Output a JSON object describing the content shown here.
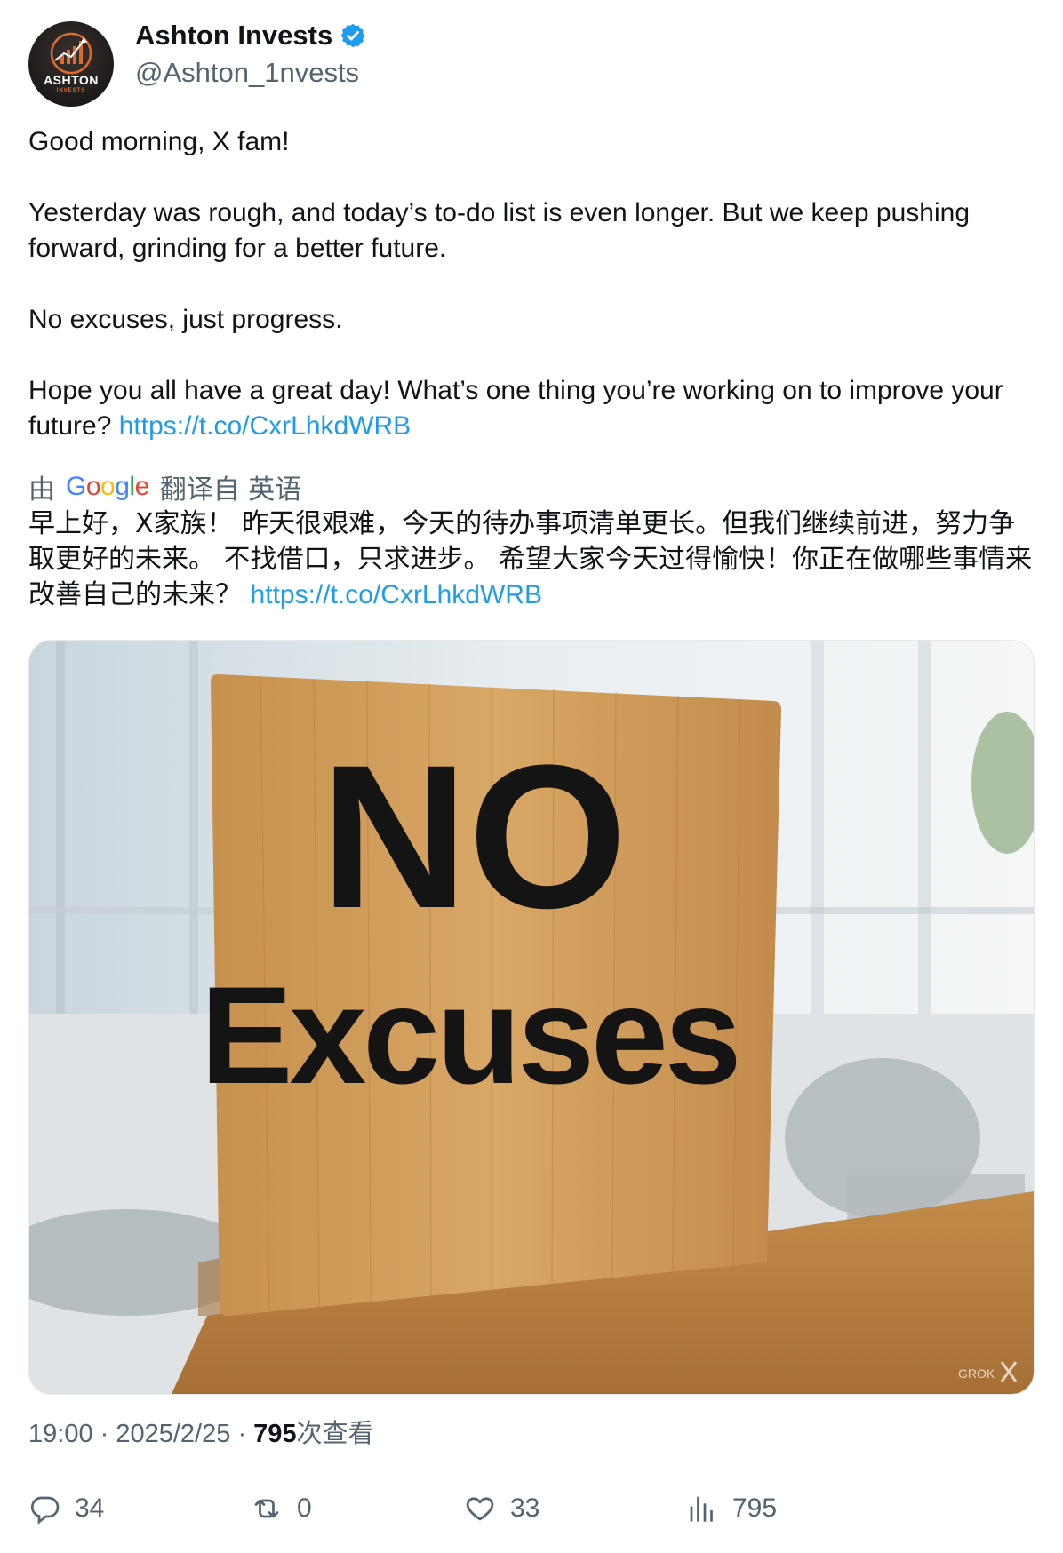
{
  "author": {
    "display_name": "Ashton Invests",
    "handle": "@Ashton_1nvests",
    "avatar_text": "ASHTON",
    "avatar_subtext": "INVESTS",
    "verified": true
  },
  "tweet": {
    "paragraphs": [
      "Good morning, X fam!",
      "Yesterday was rough, and today’s to-do list is even longer. But we keep pushing forward, grinding for a better future.",
      "No excuses, just progress.",
      "Hope you all have a great day! What’s one thing you’re working on to improve your future?"
    ],
    "link": "https://t.co/CxrLhkdWRB"
  },
  "translation": {
    "prefix": "由",
    "provider": "Google",
    "label": "翻译自 英语",
    "text": "早上好，X家族！ 昨天很艰难，今天的待办事项清单更长。但我们继续前进，努力争取更好的未来。 不找借口，只求进步。 希望大家今天过得愉快！你正在做哪些事情来改善自己的未来？",
    "link": "https://t.co/CxrLhkdWRB"
  },
  "media": {
    "sign_line1": "NO",
    "sign_line2": "Excuses",
    "watermark": "GROK"
  },
  "meta": {
    "time": "19:00",
    "date": "2025/2/25",
    "views_count": "795",
    "views_label": "次查看"
  },
  "actions": {
    "replies": "34",
    "reposts": "0",
    "likes": "33",
    "views": "795"
  },
  "colors": {
    "link": "#1d9bf0",
    "secondary_text": "#536471",
    "verified": "#1d9bf0"
  }
}
